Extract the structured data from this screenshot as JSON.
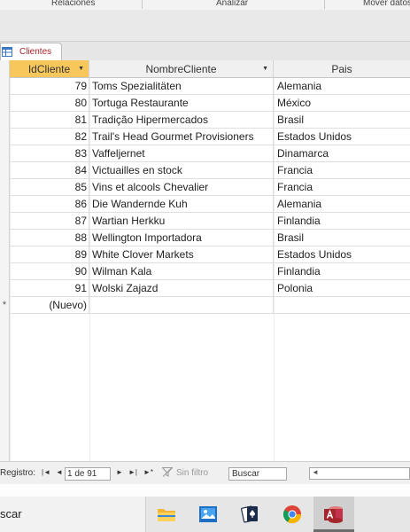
{
  "ribbon": {
    "groups": [
      "Relaciones",
      "Analizar",
      "Mover datos"
    ]
  },
  "document_tab": {
    "label": "Clientes",
    "icon": "table-icon",
    "accent_color": "#a4262c"
  },
  "datasheet": {
    "columns": [
      {
        "label": "IdCliente",
        "sort_indicator": "▼"
      },
      {
        "label": "NombreCliente",
        "sort_indicator": "▼"
      },
      {
        "label": "Pais"
      }
    ],
    "active_column_color": "#f7c75c",
    "rows": [
      {
        "id": "79",
        "name": "Toms Spezialitäten",
        "country": "Alemania"
      },
      {
        "id": "80",
        "name": "Tortuga Restaurante",
        "country": "México"
      },
      {
        "id": "81",
        "name": "Tradição Hipermercados",
        "country": "Brasil"
      },
      {
        "id": "82",
        "name": "Trail's Head Gourmet Provisioners",
        "country": "Estados Unidos"
      },
      {
        "id": "83",
        "name": "Vaffeljernet",
        "country": "Dinamarca"
      },
      {
        "id": "84",
        "name": "Victuailles en stock",
        "country": "Francia"
      },
      {
        "id": "85",
        "name": "Vins et alcools Chevalier",
        "country": "Francia"
      },
      {
        "id": "86",
        "name": "Die Wandernde Kuh",
        "country": "Alemania"
      },
      {
        "id": "87",
        "name": "Wartian Herkku",
        "country": "Finlandia"
      },
      {
        "id": "88",
        "name": "Wellington Importadora",
        "country": "Brasil"
      },
      {
        "id": "89",
        "name": "White Clover Markets",
        "country": "Estados Unidos"
      },
      {
        "id": "90",
        "name": "Wilman Kala",
        "country": "Finlandia"
      },
      {
        "id": "91",
        "name": "Wolski  Zajazd",
        "country": "Polonia"
      }
    ],
    "new_row": {
      "marker": "*",
      "label": "(Nuevo)"
    }
  },
  "record_nav": {
    "label": "Registro:",
    "first_glyph": "|◄",
    "prev_glyph": "◄",
    "position": "1 de 91",
    "next_glyph": "►",
    "last_glyph": "►|",
    "new_glyph": "►*",
    "filter_label": "Sin filtro",
    "search_value": "Buscar",
    "scroll_left_glyph": "◄"
  },
  "taskbar": {
    "search_text": "scar",
    "apps": [
      "file-explorer-icon",
      "photos-icon",
      "solitaire-icon",
      "chrome-icon",
      "access-icon"
    ],
    "active_app": "access-icon"
  }
}
